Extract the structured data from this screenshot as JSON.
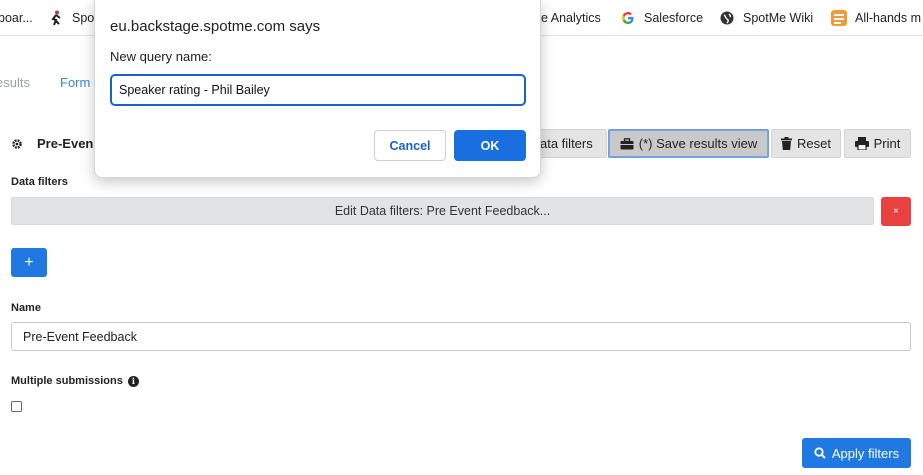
{
  "bookmarks": [
    {
      "label": "boar...",
      "icon": "grid-icon"
    },
    {
      "label": "Spo",
      "icon": "runner-icon"
    },
    {
      "label": "e Analytics",
      "icon": ""
    },
    {
      "label": "Salesforce",
      "icon": "google-icon"
    },
    {
      "label": "SpotMe Wiki",
      "icon": "globe-icon"
    },
    {
      "label": "All-hands m",
      "icon": "orange-app-icon"
    }
  ],
  "tabs": {
    "results": "esults",
    "forms": "Form"
  },
  "toolbar": {
    "title": "Pre-Even",
    "data_filters": "ata filters",
    "save_results_view": "(*) Save results view",
    "reset": "Reset",
    "print": "Print"
  },
  "filters": {
    "label": "Data filters",
    "edit": "Edit Data filters: Pre Event Feedback...",
    "remove": "×",
    "add": "+"
  },
  "form": {
    "name_label": "Name",
    "name_value": "Pre-Event Feedback",
    "multiple_label": "Multiple submissions",
    "multiple_checked": false
  },
  "apply_label": "Apply filters",
  "dialog": {
    "title": "eu.backstage.spotme.com says",
    "message": "New query name:",
    "value": "Speaker rating - Phil Bailey",
    "cancel": "Cancel",
    "ok": "OK"
  },
  "colors": {
    "primary": "#1f79e0",
    "danger": "#e8413f",
    "dialog_accent": "#1a62c9"
  }
}
